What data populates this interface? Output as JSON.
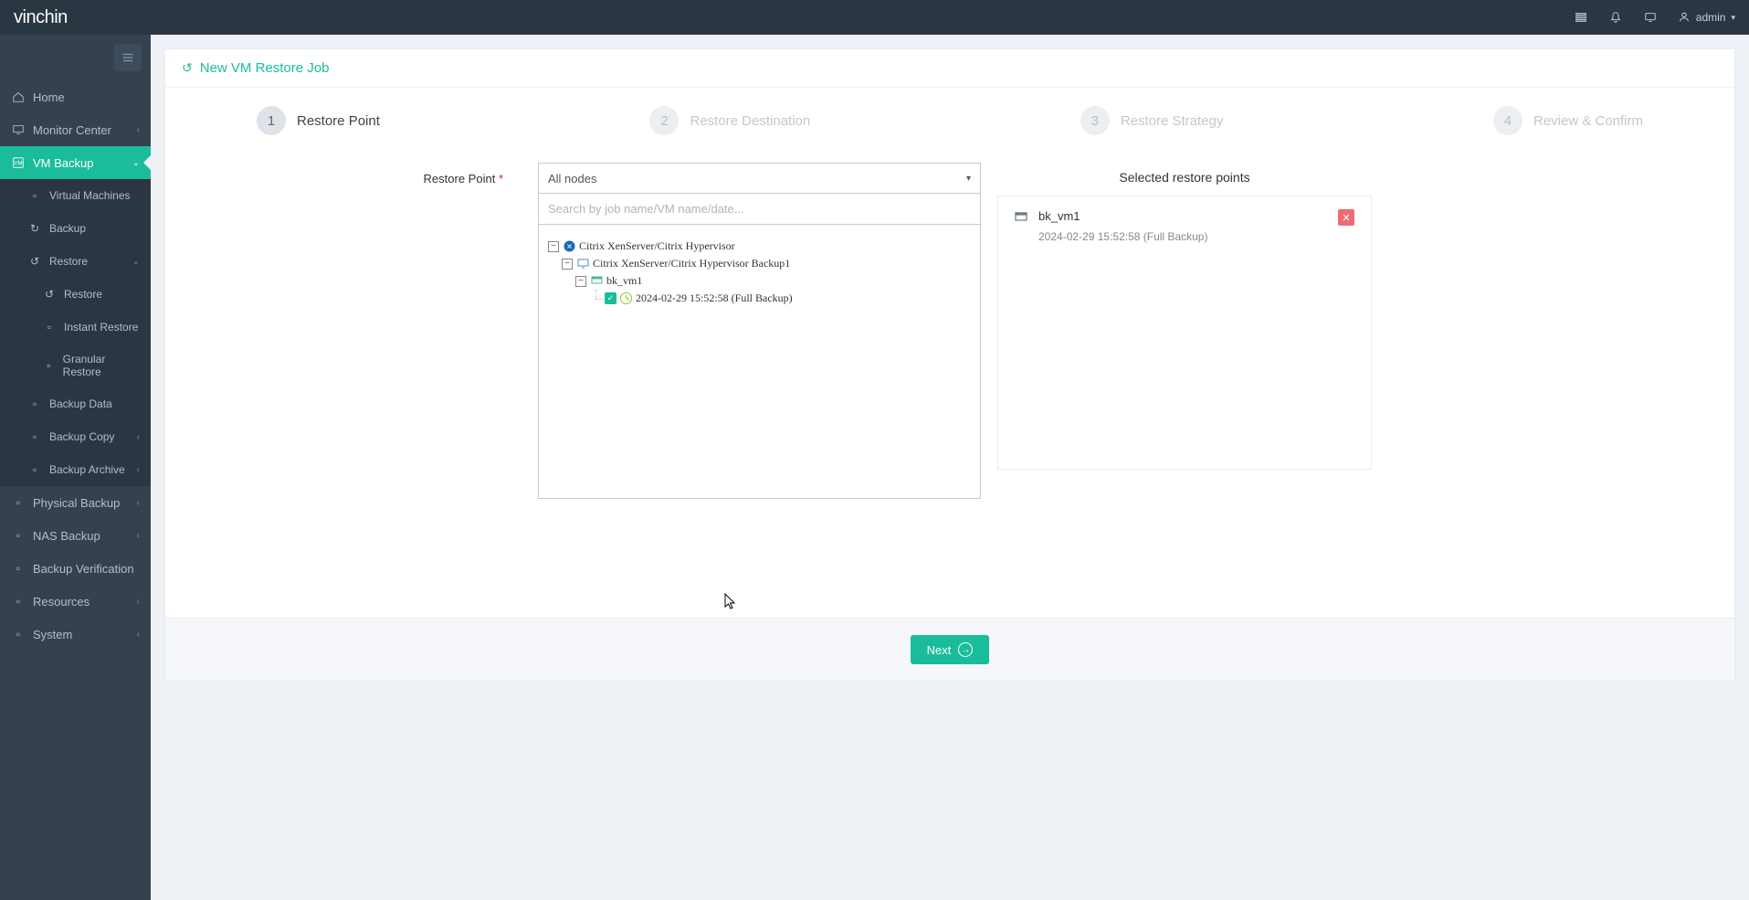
{
  "brand": {
    "part1": "vin",
    "part2": "chin"
  },
  "user": {
    "name": "admin"
  },
  "sidebar": {
    "home": "Home",
    "monitor": "Monitor Center",
    "vmbackup": "VM Backup",
    "vm_sub": {
      "vms": "Virtual Machines",
      "backup": "Backup",
      "restore": "Restore",
      "restore_sub": {
        "restore": "Restore",
        "instant": "Instant Restore",
        "granular": "Granular Restore"
      },
      "bdata": "Backup Data",
      "bcopy": "Backup Copy",
      "barchive": "Backup Archive"
    },
    "physical": "Physical Backup",
    "nas": "NAS Backup",
    "verify": "Backup Verification",
    "resources": "Resources",
    "system": "System"
  },
  "page": {
    "title": "New VM Restore Job"
  },
  "wizard": {
    "steps": [
      {
        "num": "1",
        "label": "Restore Point"
      },
      {
        "num": "2",
        "label": "Restore Destination"
      },
      {
        "num": "3",
        "label": "Restore Strategy"
      },
      {
        "num": "4",
        "label": "Review & Confirm"
      }
    ]
  },
  "form": {
    "restore_point_label": "Restore Point",
    "node_select": "All nodes",
    "search_placeholder": "Search by job name/VM name/date..."
  },
  "tree": {
    "root": "Citrix XenServer/Citrix Hypervisor",
    "job": "Citrix XenServer/Citrix Hypervisor Backup1",
    "vm": "bk_vm1",
    "point": "2024-02-29 15:52:58 (Full  Backup)"
  },
  "selected": {
    "title": "Selected restore points",
    "vm": "bk_vm1",
    "detail": "2024-02-29 15:52:58 (Full Backup)"
  },
  "buttons": {
    "next": "Next"
  }
}
